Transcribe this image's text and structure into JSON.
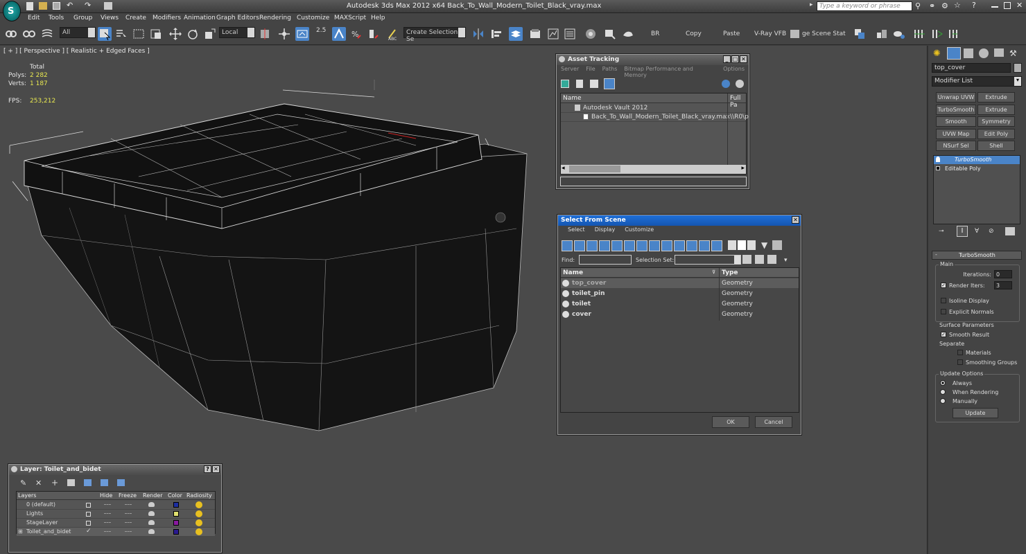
{
  "app": {
    "title": "Autodesk 3ds Max  2012 x64     Back_To_Wall_Modern_Toilet_Black_vray.max",
    "search_placeholder": "Type a keyword or phrase"
  },
  "menu": [
    "Edit",
    "Tools",
    "Group",
    "Views",
    "Create",
    "Modifiers",
    "Animation",
    "Graph Editors",
    "Rendering",
    "Customize",
    "MAXScript",
    "Help"
  ],
  "toolbar": {
    "filter": "All",
    "coord": "Local",
    "angle_snap": "2.5",
    "named_sel": "Create Selection Se",
    "br": "BR",
    "copy": "Copy",
    "paste": "Paste",
    "vray_vfb": "V-Ray VFB",
    "scene_state": "ge Scene Stat"
  },
  "viewport": {
    "label": "[ + ] [ Perspective ] [ Realistic + Edged Faces ]",
    "total_label": "Total",
    "polys_label": "Polys:",
    "polys": "2 282",
    "verts_label": "Verts:",
    "verts": "1 187",
    "fps_label": "FPS:",
    "fps": "253,212"
  },
  "asset_tracking": {
    "title": "Asset Tracking",
    "menu": [
      "Server",
      "File",
      "Paths",
      "Bitmap Performance and Memory",
      "Options"
    ],
    "col_name": "Name",
    "col_path": "Full Pa",
    "rows": [
      {
        "name": "Autodesk Vault 2012",
        "path": ""
      },
      {
        "name": "Back_To_Wall_Modern_Toilet_Black_vray.max",
        "path": "\\\\R0\\p"
      }
    ]
  },
  "select_from_scene": {
    "title": "Select From Scene",
    "menu": [
      "Select",
      "Display",
      "Customize"
    ],
    "find_label": "Find:",
    "selset_label": "Selection Set:",
    "col_name": "Name",
    "col_type": "Type",
    "rows": [
      {
        "name": "top_cover",
        "type": "Geometry"
      },
      {
        "name": "toilet_pin",
        "type": "Geometry"
      },
      {
        "name": "toilet",
        "type": "Geometry"
      },
      {
        "name": "cover",
        "type": "Geometry"
      }
    ],
    "ok": "OK",
    "cancel": "Cancel"
  },
  "layer": {
    "title": "Layer: Toilet_and_bidet",
    "cols": [
      "Layers",
      "Hide",
      "Freeze",
      "Render",
      "Color",
      "Radiosity"
    ],
    "rows": [
      {
        "name": "0 (default)",
        "color": "#1c2ea0",
        "current": false
      },
      {
        "name": "Lights",
        "color": "#e0e070",
        "current": false
      },
      {
        "name": "StageLayer",
        "color": "#8a1aa0",
        "current": false
      },
      {
        "name": "Toilet_and_bidet",
        "color": "#2a1a90",
        "current": true
      }
    ]
  },
  "command_panel": {
    "object_name": "top_cover",
    "modifier_list": "Modifier List",
    "buttons": [
      [
        "Unwrap UVW",
        "Extrude"
      ],
      [
        "TurboSmooth",
        "Extrude"
      ],
      [
        "Smooth",
        "Symmetry"
      ],
      [
        "UVW Map",
        "Edit Poly"
      ],
      [
        "NSurf Sel",
        "Shell"
      ]
    ],
    "stack": [
      {
        "name": "TurboSmooth",
        "selected": true
      },
      {
        "name": "Editable Poly",
        "selected": false
      }
    ],
    "rollout": "TurboSmooth",
    "main": "Main",
    "iterations_label": "Iterations:",
    "iterations": "0",
    "render_iters_label": "Render Iters:",
    "render_iters": "3",
    "isoline": "Isoline Display",
    "explicit_normals": "Explicit Normals",
    "surface_params": "Surface Parameters",
    "smooth_result": "Smooth Result",
    "separate": "Separate",
    "materials": "Materials",
    "smoothing_groups": "Smoothing Groups",
    "update_options": "Update Options",
    "always": "Always",
    "when_rendering": "When Rendering",
    "manually": "Manually",
    "update": "Update"
  },
  "colors": {
    "accent": "#4a84c8",
    "title_blue": "#1e6fd8",
    "stat_yellow": "#e8e850"
  }
}
